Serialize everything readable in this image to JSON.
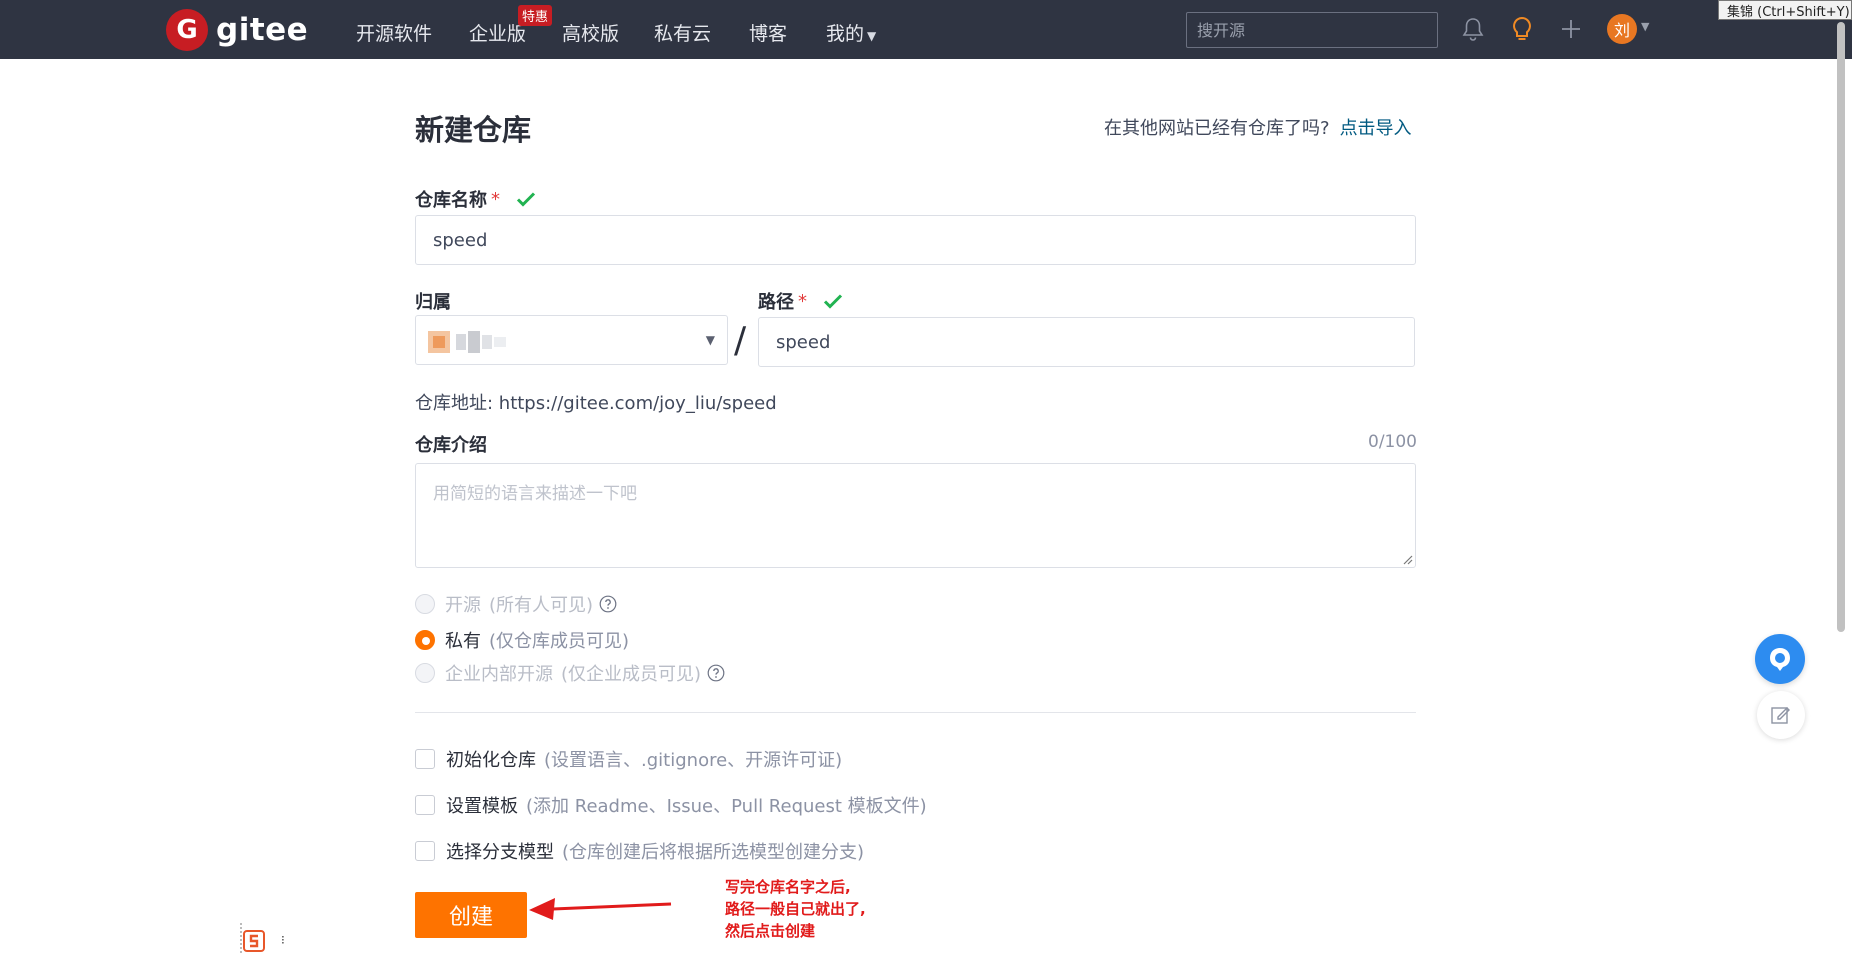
{
  "nav": {
    "logo_text": "gitee",
    "items": [
      "开源软件",
      "企业版",
      "高校版",
      "私有云",
      "博客",
      "我的"
    ],
    "badge": "特惠",
    "search_placeholder": "搜开源",
    "avatar_text": "刘",
    "tooltip": "集锦 (Ctrl+Shift+Y)"
  },
  "form": {
    "title": "新建仓库",
    "import_hint": "在其他网站已经有仓库了吗?",
    "import_link": "点击导入",
    "name_label": "仓库名称",
    "required_mark": "*",
    "name_value": "speed",
    "owner_label": "归属",
    "path_label": "路径",
    "path_value": "speed",
    "separator": "/",
    "address": "仓库地址: https://gitee.com/joy_liu/speed",
    "desc_label": "仓库介绍",
    "desc_counter": "0/100",
    "desc_placeholder": "用简短的语言来描述一下吧",
    "visibility": [
      {
        "label": "开源",
        "hint": "(所有人可见)",
        "selected": false,
        "disabled": true,
        "help": true
      },
      {
        "label": "私有",
        "hint": "(仅仓库成员可见)",
        "selected": true,
        "disabled": false,
        "help": false
      },
      {
        "label": "企业内部开源",
        "hint": "(仅企业成员可见)",
        "selected": false,
        "disabled": true,
        "help": true
      }
    ],
    "options": [
      {
        "label": "初始化仓库",
        "hint": "(设置语言、.gitignore、开源许可证)",
        "checked": false
      },
      {
        "label": "设置模板",
        "hint": "(添加 Readme、Issue、Pull Request 模板文件)",
        "checked": false
      },
      {
        "label": "选择分支模型",
        "hint": "(仓库创建后将根据所选模型创建分支)",
        "checked": false
      }
    ],
    "submit_label": "创建"
  },
  "annotation": {
    "lines": [
      "写完仓库名字之后,",
      "路径一般自己就出了,",
      "然后点击创建"
    ]
  },
  "colors": {
    "nav_bg": "#2f3442",
    "accent": "#fe7300",
    "brand_red": "#c71d23",
    "link": "#005980",
    "success": "#21b351",
    "annotation": "#e11b1b"
  }
}
